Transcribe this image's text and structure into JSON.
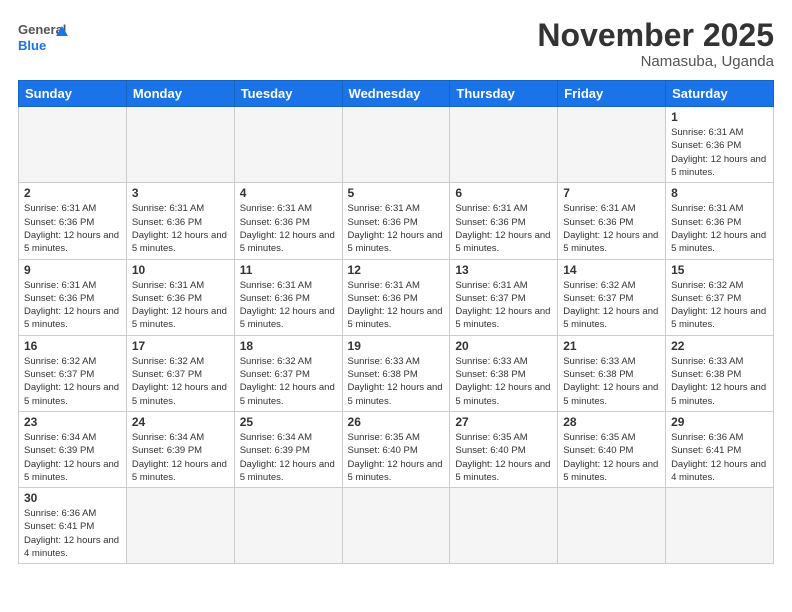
{
  "logo": {
    "general": "General",
    "blue": "Blue"
  },
  "header": {
    "month": "November 2025",
    "location": "Namasuba, Uganda"
  },
  "weekdays": [
    "Sunday",
    "Monday",
    "Tuesday",
    "Wednesday",
    "Thursday",
    "Friday",
    "Saturday"
  ],
  "weeks": [
    [
      {
        "day": "",
        "empty": true
      },
      {
        "day": "",
        "empty": true
      },
      {
        "day": "",
        "empty": true
      },
      {
        "day": "",
        "empty": true
      },
      {
        "day": "",
        "empty": true
      },
      {
        "day": "",
        "empty": true
      },
      {
        "day": "1",
        "sunrise": "6:31 AM",
        "sunset": "6:36 PM",
        "daylight": "12 hours and 5 minutes."
      }
    ],
    [
      {
        "day": "2",
        "sunrise": "6:31 AM",
        "sunset": "6:36 PM",
        "daylight": "12 hours and 5 minutes."
      },
      {
        "day": "3",
        "sunrise": "6:31 AM",
        "sunset": "6:36 PM",
        "daylight": "12 hours and 5 minutes."
      },
      {
        "day": "4",
        "sunrise": "6:31 AM",
        "sunset": "6:36 PM",
        "daylight": "12 hours and 5 minutes."
      },
      {
        "day": "5",
        "sunrise": "6:31 AM",
        "sunset": "6:36 PM",
        "daylight": "12 hours and 5 minutes."
      },
      {
        "day": "6",
        "sunrise": "6:31 AM",
        "sunset": "6:36 PM",
        "daylight": "12 hours and 5 minutes."
      },
      {
        "day": "7",
        "sunrise": "6:31 AM",
        "sunset": "6:36 PM",
        "daylight": "12 hours and 5 minutes."
      },
      {
        "day": "8",
        "sunrise": "6:31 AM",
        "sunset": "6:36 PM",
        "daylight": "12 hours and 5 minutes."
      }
    ],
    [
      {
        "day": "9",
        "sunrise": "6:31 AM",
        "sunset": "6:36 PM",
        "daylight": "12 hours and 5 minutes."
      },
      {
        "day": "10",
        "sunrise": "6:31 AM",
        "sunset": "6:36 PM",
        "daylight": "12 hours and 5 minutes."
      },
      {
        "day": "11",
        "sunrise": "6:31 AM",
        "sunset": "6:36 PM",
        "daylight": "12 hours and 5 minutes."
      },
      {
        "day": "12",
        "sunrise": "6:31 AM",
        "sunset": "6:36 PM",
        "daylight": "12 hours and 5 minutes."
      },
      {
        "day": "13",
        "sunrise": "6:31 AM",
        "sunset": "6:37 PM",
        "daylight": "12 hours and 5 minutes."
      },
      {
        "day": "14",
        "sunrise": "6:32 AM",
        "sunset": "6:37 PM",
        "daylight": "12 hours and 5 minutes."
      },
      {
        "day": "15",
        "sunrise": "6:32 AM",
        "sunset": "6:37 PM",
        "daylight": "12 hours and 5 minutes."
      }
    ],
    [
      {
        "day": "16",
        "sunrise": "6:32 AM",
        "sunset": "6:37 PM",
        "daylight": "12 hours and 5 minutes."
      },
      {
        "day": "17",
        "sunrise": "6:32 AM",
        "sunset": "6:37 PM",
        "daylight": "12 hours and 5 minutes."
      },
      {
        "day": "18",
        "sunrise": "6:32 AM",
        "sunset": "6:37 PM",
        "daylight": "12 hours and 5 minutes."
      },
      {
        "day": "19",
        "sunrise": "6:33 AM",
        "sunset": "6:38 PM",
        "daylight": "12 hours and 5 minutes."
      },
      {
        "day": "20",
        "sunrise": "6:33 AM",
        "sunset": "6:38 PM",
        "daylight": "12 hours and 5 minutes."
      },
      {
        "day": "21",
        "sunrise": "6:33 AM",
        "sunset": "6:38 PM",
        "daylight": "12 hours and 5 minutes."
      },
      {
        "day": "22",
        "sunrise": "6:33 AM",
        "sunset": "6:38 PM",
        "daylight": "12 hours and 5 minutes."
      }
    ],
    [
      {
        "day": "23",
        "sunrise": "6:34 AM",
        "sunset": "6:39 PM",
        "daylight": "12 hours and 5 minutes."
      },
      {
        "day": "24",
        "sunrise": "6:34 AM",
        "sunset": "6:39 PM",
        "daylight": "12 hours and 5 minutes."
      },
      {
        "day": "25",
        "sunrise": "6:34 AM",
        "sunset": "6:39 PM",
        "daylight": "12 hours and 5 minutes."
      },
      {
        "day": "26",
        "sunrise": "6:35 AM",
        "sunset": "6:40 PM",
        "daylight": "12 hours and 5 minutes."
      },
      {
        "day": "27",
        "sunrise": "6:35 AM",
        "sunset": "6:40 PM",
        "daylight": "12 hours and 5 minutes."
      },
      {
        "day": "28",
        "sunrise": "6:35 AM",
        "sunset": "6:40 PM",
        "daylight": "12 hours and 5 minutes."
      },
      {
        "day": "29",
        "sunrise": "6:36 AM",
        "sunset": "6:41 PM",
        "daylight": "12 hours and 4 minutes."
      }
    ],
    [
      {
        "day": "30",
        "sunrise": "6:36 AM",
        "sunset": "6:41 PM",
        "daylight": "12 hours and 4 minutes."
      },
      {
        "day": "",
        "empty": true
      },
      {
        "day": "",
        "empty": true
      },
      {
        "day": "",
        "empty": true
      },
      {
        "day": "",
        "empty": true
      },
      {
        "day": "",
        "empty": true
      },
      {
        "day": "",
        "empty": true
      }
    ]
  ],
  "labels": {
    "sunrise": "Sunrise:",
    "sunset": "Sunset:",
    "daylight": "Daylight:"
  }
}
